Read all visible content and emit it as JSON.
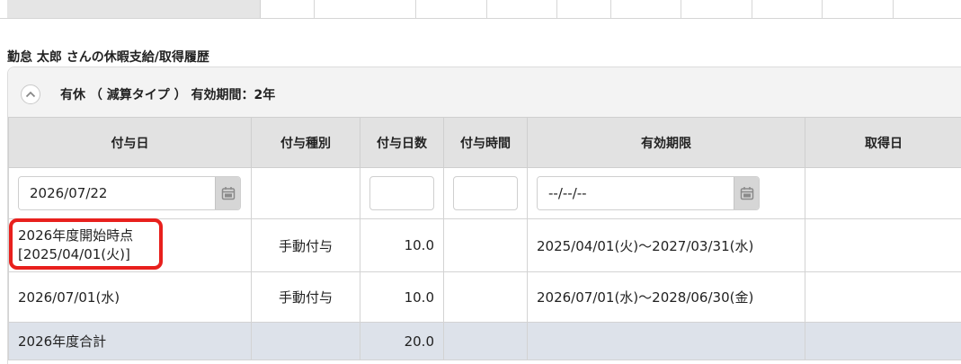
{
  "history_title": "勤怠 太郎 さんの休暇支給/取得履歴",
  "leave": {
    "title": "有休 （ 減算タイプ ） 有効期間：2年"
  },
  "columns": [
    "付与日",
    "付与種別",
    "付与日数",
    "付与時間",
    "有効期限",
    "取得日"
  ],
  "input_row": {
    "grant_date_value": "2026/07/22",
    "expiry_placeholder": "--/--/--"
  },
  "rows": [
    {
      "grant_date_line1": "2026年度開始時点",
      "grant_date_line2": "[2025/04/01(火)]",
      "grant_type": "手動付与",
      "grant_days": "10.0",
      "grant_hours": "",
      "expiry": "2025/04/01(火)～2027/03/31(水)",
      "taken_date": ""
    },
    {
      "grant_date": "2026/07/01(水)",
      "grant_type": "手動付与",
      "grant_days": "10.0",
      "grant_hours": "",
      "expiry": "2026/07/01(水)～2028/06/30(金)",
      "taken_date": ""
    }
  ],
  "total_row": {
    "label": "2026年度合計",
    "grant_days": "20.0"
  },
  "colors": {
    "header_bg": "#e2e2e2",
    "total_bg": "#dde2ea",
    "highlight": "#e8201d"
  },
  "icons": {
    "collapse": "chevron-up-icon",
    "calendar": "calendar-icon"
  }
}
